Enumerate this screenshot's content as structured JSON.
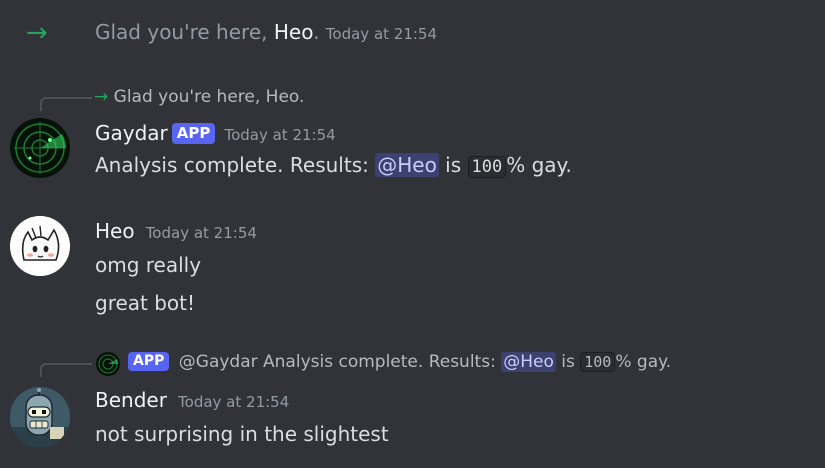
{
  "system_message": {
    "prefix": "Glad you're here, ",
    "username": "Heo",
    "suffix": ".",
    "timestamp": "Today at 21:54"
  },
  "messages": [
    {
      "reply_preview": {
        "arrow": "→",
        "text": "Glad you're here, Heo."
      },
      "author": "Gaydar",
      "badge": "APP",
      "timestamp": "Today at 21:54",
      "content": {
        "before": "Analysis complete. Results: ",
        "mention": "@Heo",
        "middle": " is ",
        "code": "100",
        "after": "% gay."
      },
      "avatar_icon": "radar-icon"
    },
    {
      "author": "Heo",
      "timestamp": "Today at 21:54",
      "lines": [
        "omg really",
        "great bot!"
      ],
      "avatar_icon": "white-cat-icon"
    },
    {
      "reply_preview": {
        "badge": "APP",
        "author": "@Gaydar",
        "before": " Analysis complete. Results: ",
        "mention": "@Heo",
        "middle": " is ",
        "code": "100",
        "after": "% gay."
      },
      "author": "Bender",
      "timestamp": "Today at 21:54",
      "content": "not surprising in the slightest",
      "avatar_icon": "robot-icon"
    }
  ],
  "colors": {
    "background": "#313338",
    "accent": "#5865f2",
    "join_arrow": "#23a55a"
  }
}
